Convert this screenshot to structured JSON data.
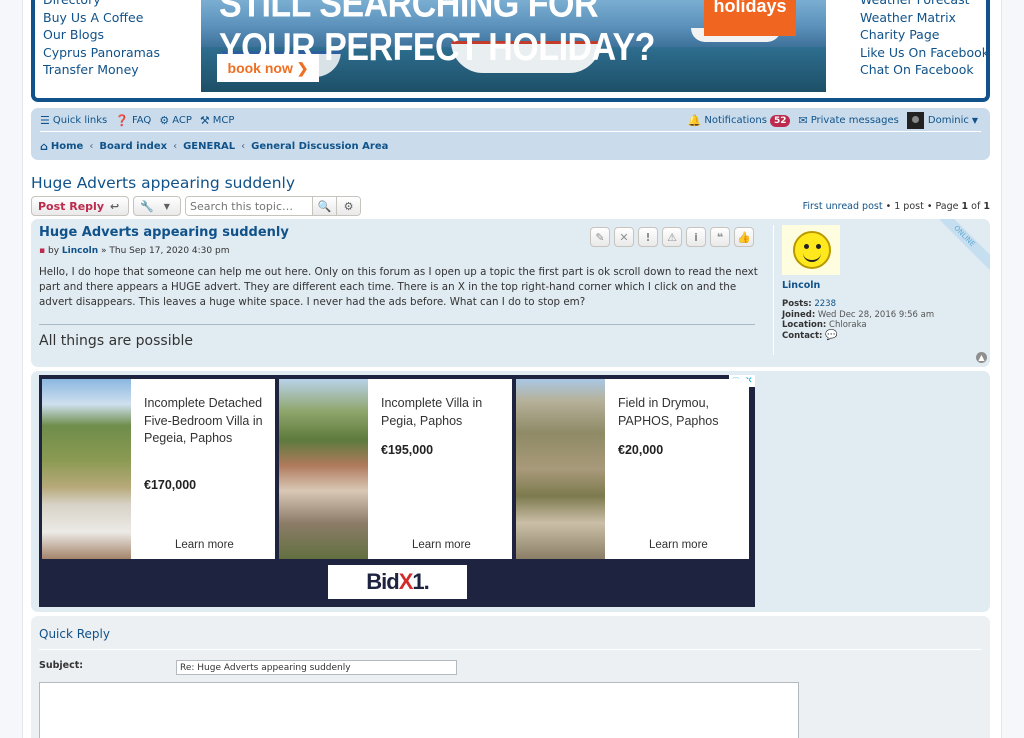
{
  "header": {
    "left_links": [
      "Directory",
      "Buy Us A Coffee",
      "Our Blogs",
      "Cyprus Panoramas",
      "Transfer Money"
    ],
    "right_links": [
      "Weather Forecast",
      "Weather Matrix",
      "Charity Page",
      "Like Us On Facebook",
      "Chat On Facebook"
    ],
    "banner": {
      "headline_line1": "STILL SEARCHING FOR",
      "headline_line2": "YOUR PERFECT HOLIDAY?",
      "cta": "book now ❯",
      "brand": "holidays"
    }
  },
  "navbar": {
    "quick_links": "Quick links",
    "faq": "FAQ",
    "acp": "ACP",
    "mcp": "MCP",
    "notifications": "Notifications",
    "notification_count": "52",
    "private_messages": "Private messages",
    "username": "Dominic",
    "breadcrumbs": [
      "Home",
      "Board index",
      "GENERAL",
      "General Discussion Area"
    ]
  },
  "topic": {
    "title": "Huge Adverts appearing suddenly",
    "post_reply": "Post Reply",
    "search_placeholder": "Search this topic…",
    "pagination": {
      "first_unread": "First unread post",
      "post_count": "1 post",
      "page_label": "Page",
      "page_current": "1",
      "of": "of",
      "page_total": "1"
    }
  },
  "post": {
    "title": "Huge Adverts appearing suddenly",
    "by": "by",
    "author": "Lincoln",
    "date": "» Thu Sep 17, 2020 4:30 pm",
    "body": "Hello, I do hope that someone can help me out here. Only on this forum as I open up a topic the first part is ok scroll down to read the next part and there appears a HUGE advert. They are different each time. There is an X in the top right-hand corner which I click on and the advert disappears. This leaves a huge white space. I never had the ads before. What can I do to stop em?",
    "signature": "All things are possible",
    "online_label": "ONLINE",
    "buttons": [
      "✎",
      "✕",
      "!",
      "⚠",
      "i",
      "❝",
      "👍"
    ],
    "profile": {
      "username": "Lincoln",
      "posts_label": "Posts:",
      "posts": "2238",
      "joined_label": "Joined:",
      "joined": "Wed Dec 28, 2016 9:56 am",
      "location_label": "Location:",
      "location": "Chloraka",
      "contact_label": "Contact:"
    }
  },
  "ad": {
    "cards": [
      {
        "title": "Incomplete Detached Five-Bedroom Villa in Pegeia, Paphos",
        "price": "€170,000",
        "cta": "Learn more"
      },
      {
        "title": "Incomplete Villa in Pegia, Paphos",
        "price": "€195,000",
        "cta": "Learn more"
      },
      {
        "title": "Field in Drymou, PAPHOS, Paphos",
        "price": "€20,000",
        "cta": "Learn more"
      }
    ],
    "brand_left": "Bid",
    "brand_x": "X",
    "brand_right": "1."
  },
  "quick_reply": {
    "title": "Quick Reply",
    "subject_label": "Subject:",
    "subject_value": "Re: Huge Adverts appearing suddenly"
  },
  "colors": {
    "link": "#105289",
    "reply_red": "#bc2a4d",
    "nav_bg": "#cadceb",
    "post_bg": "#e1ebf2"
  }
}
